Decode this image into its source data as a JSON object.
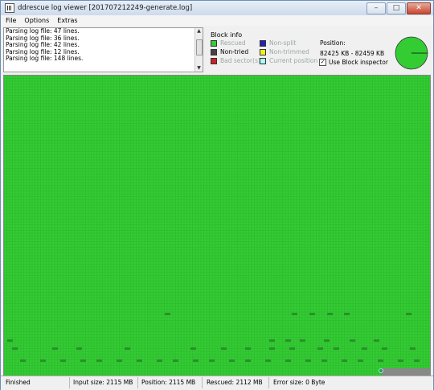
{
  "window": {
    "title": "ddrescue log viewer [201707212249-generate.log]"
  },
  "window_buttons": {
    "minimize": "–",
    "maximize": "□",
    "close": "✕"
  },
  "menu": [
    "File",
    "Options",
    "Extras"
  ],
  "log_lines": [
    "Parsing log file: 47 lines.",
    "Parsing log file: 36 lines.",
    "Parsing log file: 42 lines.",
    "Parsing log file: 12 lines.",
    "Parsing log file: 148 lines."
  ],
  "block_info": {
    "title": "Block info",
    "legend": [
      {
        "label": "Rescued",
        "color": "#33cc33",
        "dim": true
      },
      {
        "label": "Non-tried",
        "color": "#444444",
        "dim": false
      },
      {
        "label": "Bad sector(s)",
        "color": "#cc2222",
        "dim": true
      },
      {
        "label": "Non-split",
        "color": "#2222bb",
        "dim": true
      },
      {
        "label": "Non-trimmed",
        "color": "#eeee22",
        "dim": true
      },
      {
        "label": "Current position",
        "color": "#aaffff",
        "dim": true
      }
    ],
    "position_label": "Position:",
    "position_value": "82425 KB - 82459 KB",
    "use_block_inspector": "Use Block inspector",
    "inspector_checked": true,
    "rescued_fraction": 0.9986
  },
  "colors": {
    "rescued": "#33cc33",
    "grid_line": "#2aa82a",
    "nontried": "#888888",
    "current": "#1f9e6f"
  },
  "status": {
    "state": "Finished",
    "input_size": "Input size: 2115 MB",
    "position": "Position: 2115 MB",
    "rescued": "Rescued: 2112 MB",
    "error_size": "Error size: 0 Byte"
  }
}
